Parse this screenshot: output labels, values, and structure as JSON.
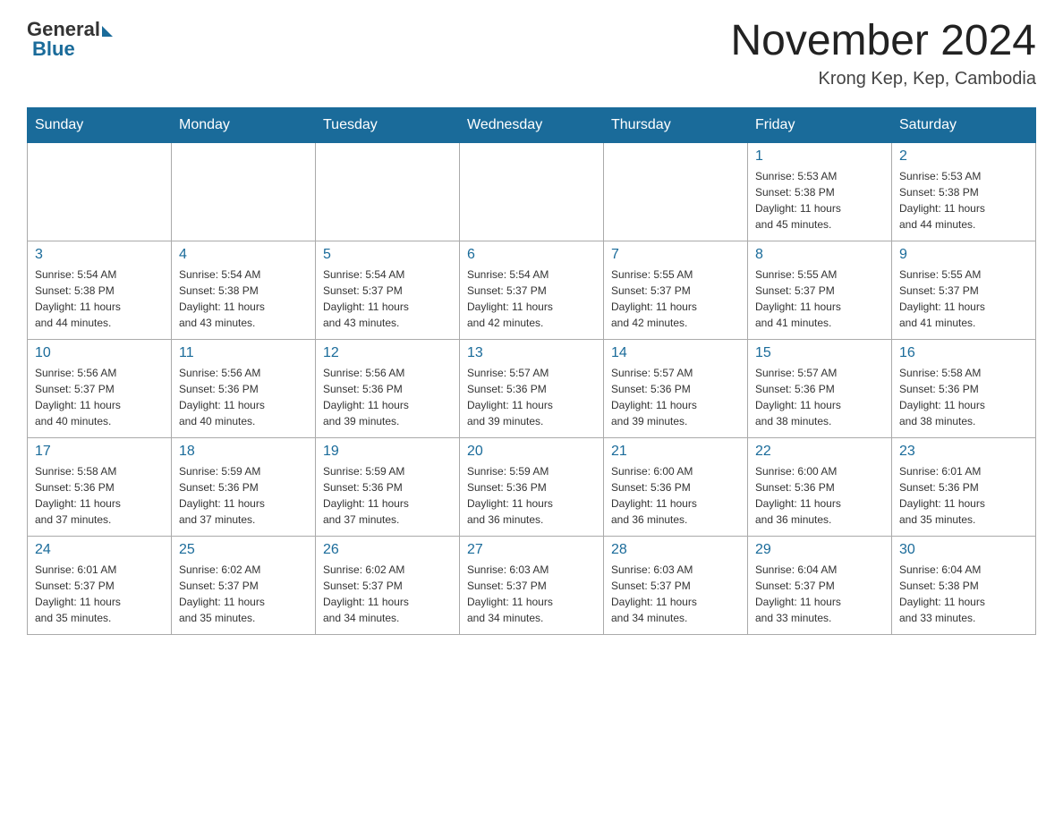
{
  "header": {
    "title": "November 2024",
    "location": "Krong Kep, Kep, Cambodia",
    "logo_general": "General",
    "logo_blue": "Blue"
  },
  "days_of_week": [
    "Sunday",
    "Monday",
    "Tuesday",
    "Wednesday",
    "Thursday",
    "Friday",
    "Saturday"
  ],
  "weeks": [
    [
      {
        "day": "",
        "info": ""
      },
      {
        "day": "",
        "info": ""
      },
      {
        "day": "",
        "info": ""
      },
      {
        "day": "",
        "info": ""
      },
      {
        "day": "",
        "info": ""
      },
      {
        "day": "1",
        "info": "Sunrise: 5:53 AM\nSunset: 5:38 PM\nDaylight: 11 hours\nand 45 minutes."
      },
      {
        "day": "2",
        "info": "Sunrise: 5:53 AM\nSunset: 5:38 PM\nDaylight: 11 hours\nand 44 minutes."
      }
    ],
    [
      {
        "day": "3",
        "info": "Sunrise: 5:54 AM\nSunset: 5:38 PM\nDaylight: 11 hours\nand 44 minutes."
      },
      {
        "day": "4",
        "info": "Sunrise: 5:54 AM\nSunset: 5:38 PM\nDaylight: 11 hours\nand 43 minutes."
      },
      {
        "day": "5",
        "info": "Sunrise: 5:54 AM\nSunset: 5:37 PM\nDaylight: 11 hours\nand 43 minutes."
      },
      {
        "day": "6",
        "info": "Sunrise: 5:54 AM\nSunset: 5:37 PM\nDaylight: 11 hours\nand 42 minutes."
      },
      {
        "day": "7",
        "info": "Sunrise: 5:55 AM\nSunset: 5:37 PM\nDaylight: 11 hours\nand 42 minutes."
      },
      {
        "day": "8",
        "info": "Sunrise: 5:55 AM\nSunset: 5:37 PM\nDaylight: 11 hours\nand 41 minutes."
      },
      {
        "day": "9",
        "info": "Sunrise: 5:55 AM\nSunset: 5:37 PM\nDaylight: 11 hours\nand 41 minutes."
      }
    ],
    [
      {
        "day": "10",
        "info": "Sunrise: 5:56 AM\nSunset: 5:37 PM\nDaylight: 11 hours\nand 40 minutes."
      },
      {
        "day": "11",
        "info": "Sunrise: 5:56 AM\nSunset: 5:36 PM\nDaylight: 11 hours\nand 40 minutes."
      },
      {
        "day": "12",
        "info": "Sunrise: 5:56 AM\nSunset: 5:36 PM\nDaylight: 11 hours\nand 39 minutes."
      },
      {
        "day": "13",
        "info": "Sunrise: 5:57 AM\nSunset: 5:36 PM\nDaylight: 11 hours\nand 39 minutes."
      },
      {
        "day": "14",
        "info": "Sunrise: 5:57 AM\nSunset: 5:36 PM\nDaylight: 11 hours\nand 39 minutes."
      },
      {
        "day": "15",
        "info": "Sunrise: 5:57 AM\nSunset: 5:36 PM\nDaylight: 11 hours\nand 38 minutes."
      },
      {
        "day": "16",
        "info": "Sunrise: 5:58 AM\nSunset: 5:36 PM\nDaylight: 11 hours\nand 38 minutes."
      }
    ],
    [
      {
        "day": "17",
        "info": "Sunrise: 5:58 AM\nSunset: 5:36 PM\nDaylight: 11 hours\nand 37 minutes."
      },
      {
        "day": "18",
        "info": "Sunrise: 5:59 AM\nSunset: 5:36 PM\nDaylight: 11 hours\nand 37 minutes."
      },
      {
        "day": "19",
        "info": "Sunrise: 5:59 AM\nSunset: 5:36 PM\nDaylight: 11 hours\nand 37 minutes."
      },
      {
        "day": "20",
        "info": "Sunrise: 5:59 AM\nSunset: 5:36 PM\nDaylight: 11 hours\nand 36 minutes."
      },
      {
        "day": "21",
        "info": "Sunrise: 6:00 AM\nSunset: 5:36 PM\nDaylight: 11 hours\nand 36 minutes."
      },
      {
        "day": "22",
        "info": "Sunrise: 6:00 AM\nSunset: 5:36 PM\nDaylight: 11 hours\nand 36 minutes."
      },
      {
        "day": "23",
        "info": "Sunrise: 6:01 AM\nSunset: 5:36 PM\nDaylight: 11 hours\nand 35 minutes."
      }
    ],
    [
      {
        "day": "24",
        "info": "Sunrise: 6:01 AM\nSunset: 5:37 PM\nDaylight: 11 hours\nand 35 minutes."
      },
      {
        "day": "25",
        "info": "Sunrise: 6:02 AM\nSunset: 5:37 PM\nDaylight: 11 hours\nand 35 minutes."
      },
      {
        "day": "26",
        "info": "Sunrise: 6:02 AM\nSunset: 5:37 PM\nDaylight: 11 hours\nand 34 minutes."
      },
      {
        "day": "27",
        "info": "Sunrise: 6:03 AM\nSunset: 5:37 PM\nDaylight: 11 hours\nand 34 minutes."
      },
      {
        "day": "28",
        "info": "Sunrise: 6:03 AM\nSunset: 5:37 PM\nDaylight: 11 hours\nand 34 minutes."
      },
      {
        "day": "29",
        "info": "Sunrise: 6:04 AM\nSunset: 5:37 PM\nDaylight: 11 hours\nand 33 minutes."
      },
      {
        "day": "30",
        "info": "Sunrise: 6:04 AM\nSunset: 5:38 PM\nDaylight: 11 hours\nand 33 minutes."
      }
    ]
  ]
}
